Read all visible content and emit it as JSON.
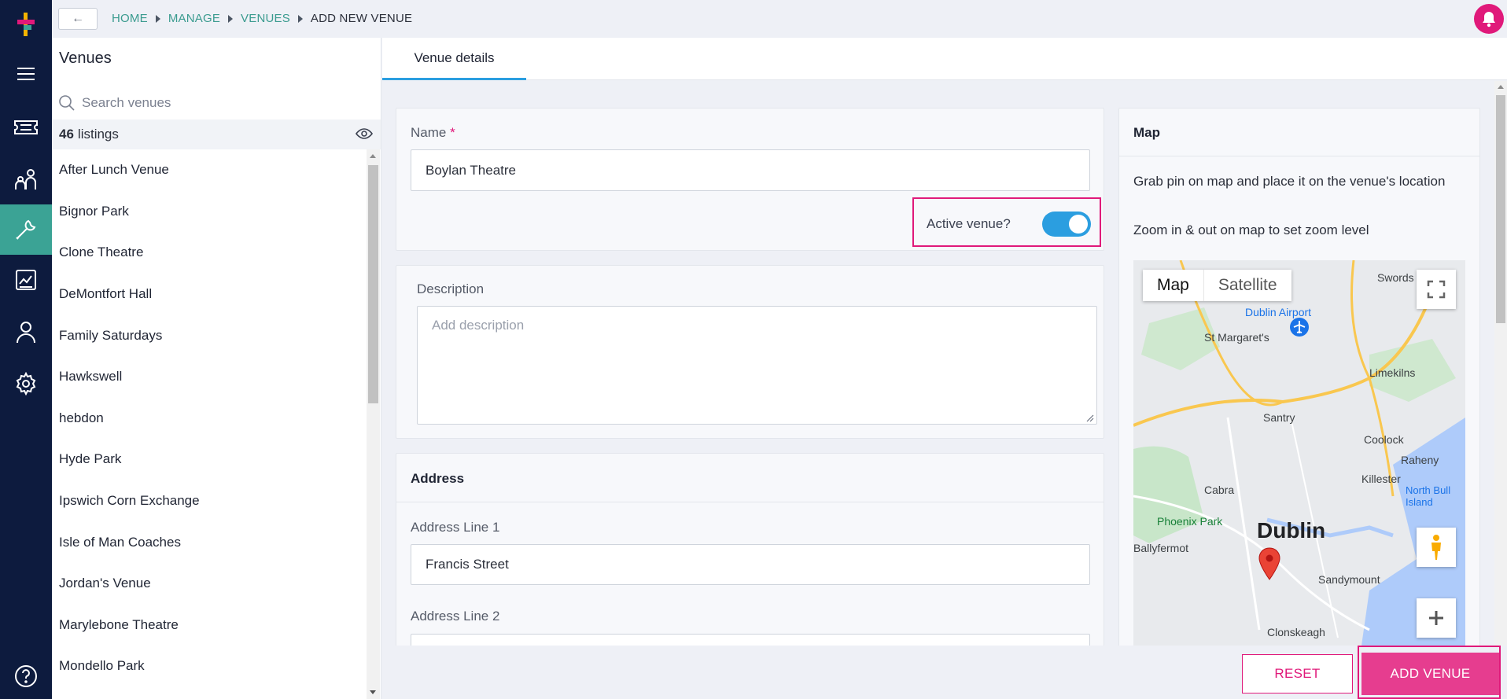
{
  "breadcrumbs": [
    "HOME",
    "MANAGE",
    "VENUES",
    "ADD NEW VENUE"
  ],
  "sidebar_title": "Venues",
  "search": {
    "placeholder": "Search venues"
  },
  "listing_count": "46",
  "listing_word": "listings",
  "venues": [
    "After Lunch Venue",
    "Bignor Park",
    "Clone Theatre",
    "DeMontfort Hall",
    "Family Saturdays",
    "Hawkswell",
    "hebdon",
    "Hyde Park",
    "Ipswich Corn Exchange",
    "Isle of Man Coaches",
    "Jordan's Venue",
    "Marylebone Theatre",
    "Mondello Park"
  ],
  "tab": "Venue details",
  "form": {
    "name_label": "Name",
    "name_required": "*",
    "name_value": "Boylan Theatre",
    "active_label": "Active venue?",
    "active_on": true,
    "description_label": "Description",
    "description_placeholder": "Add description",
    "address_title": "Address",
    "address1_label": "Address Line 1",
    "address1_value": "Francis Street",
    "address2_label": "Address Line 2"
  },
  "map": {
    "title": "Map",
    "help1": "Grab pin on map and place it on the venue's location",
    "help2": "Zoom in & out on map to set zoom level",
    "type_map": "Map",
    "type_satellite": "Satellite",
    "city": "Dublin",
    "places": [
      "Dublin Airport",
      "St Margaret's",
      "Swords",
      "Santry",
      "Coolock",
      "Killester",
      "Raheny",
      "Cabra",
      "Phoenix Park",
      "Ballyfermot",
      "Sandymount",
      "Clonskeagh",
      "Limekilns",
      "North Bull Island"
    ]
  },
  "buttons": {
    "reset": "RESET",
    "add": "ADD VENUE"
  },
  "colors": {
    "accent": "#e0197a",
    "teal": "#3ba395",
    "nav": "#0d1b3e",
    "toggle": "#2b9ee0"
  }
}
